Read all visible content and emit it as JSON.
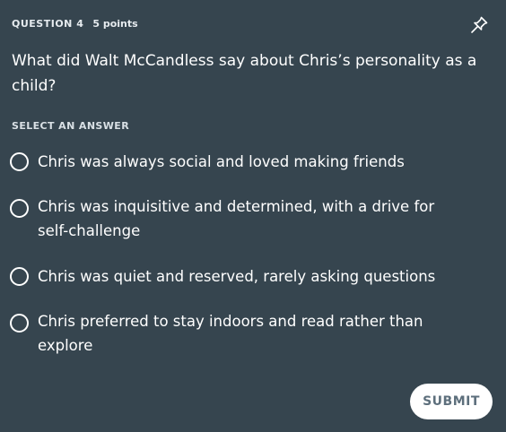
{
  "question": {
    "number_label": "QUESTION 4",
    "points_label": "5 points",
    "text": "What did Walt McCandless say about Chris’s personality as a child?",
    "pin_icon": "pin-icon"
  },
  "answer_section": {
    "label": "SELECT AN ANSWER",
    "options": [
      {
        "text": "Chris was always social and loved making friends",
        "selected": false
      },
      {
        "text": "Chris was inquisitive and determined, with a drive for self-challenge",
        "selected": false
      },
      {
        "text": "Chris was quiet and reserved, rarely asking questions",
        "selected": false
      },
      {
        "text": "Chris preferred to stay indoors and read rather than explore",
        "selected": false
      }
    ]
  },
  "actions": {
    "submit_label": "SUBMIT"
  },
  "colors": {
    "background": "#36454f",
    "text": "#ffffff",
    "submit_text": "#5d6f7c"
  }
}
